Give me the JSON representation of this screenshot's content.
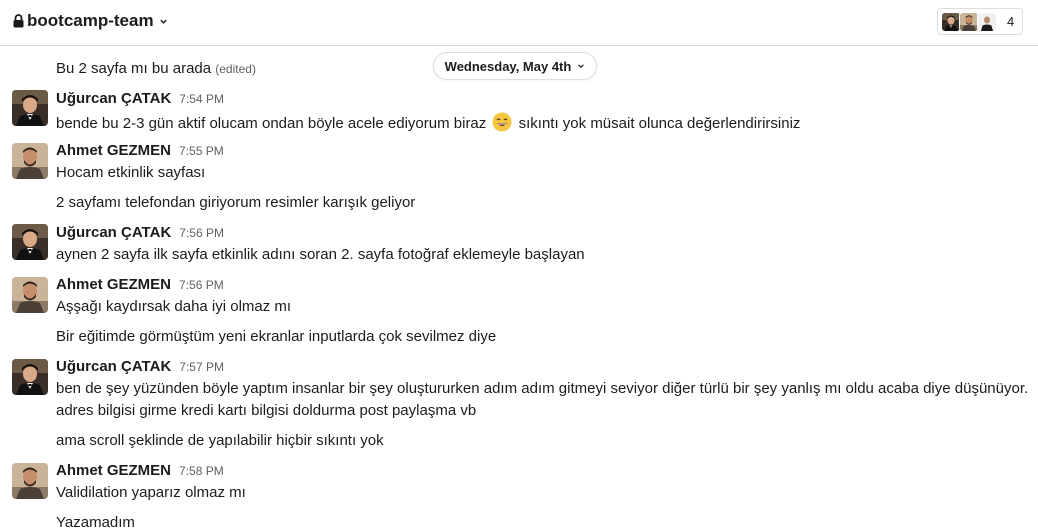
{
  "channel": {
    "name": "bootcamp-team",
    "member_count": "4"
  },
  "date_divider": "Wednesday, May 4th",
  "first_line": {
    "text": "Bu 2 sayfa mı bu arada",
    "edited": "(edited)"
  },
  "users": {
    "ugurcan": {
      "name": "Uğurcan ÇATAK"
    },
    "ahmet": {
      "name": "Ahmet GEZMEN"
    }
  },
  "messages": [
    {
      "sender": "Uğurcan ÇATAK",
      "time": "7:54 PM",
      "text_before": "bende bu 2-3 gün aktif olucam ondan böyle acele ediyorum biraz",
      "emoji": "smile-emoji",
      "text_after": "sıkıntı yok müsait olunca değerlendirirsiniz"
    },
    {
      "sender": "Ahmet GEZMEN",
      "time": "7:55 PM",
      "lines": [
        "Hocam etkinlik sayfası",
        "2 sayfamı telefondan giriyorum resimler karışık geliyor"
      ]
    },
    {
      "sender": "Uğurcan ÇATAK",
      "time": "7:56 PM",
      "lines": [
        "aynen 2 sayfa ilk sayfa etkinlik adını soran 2. sayfa fotoğraf eklemeyle başlayan"
      ]
    },
    {
      "sender": "Ahmet GEZMEN",
      "time": "7:56 PM",
      "lines": [
        "Aşşağı kaydırsak daha iyi olmaz mı",
        "Bir eğitimde görmüştüm yeni ekranlar inputlarda çok sevilmez diye"
      ]
    },
    {
      "sender": "Uğurcan ÇATAK",
      "time": "7:57 PM",
      "lines": [
        "ben de şey yüzünden böyle yaptım insanlar bir şey oluştururken adım adım gitmeyi seviyor diğer türlü bir şey yanlış mı oldu acaba diye düşünüyor.",
        "adres bilgisi girme kredi kartı bilgisi doldurma post paylaşma vb",
        "ama scroll şeklinde de yapılabilir hiçbir sıkıntı yok"
      ]
    },
    {
      "sender": "Ahmet GEZMEN",
      "time": "7:58 PM",
      "lines": [
        "Validilation yaparız olmaz mı",
        "Yazamadım"
      ]
    }
  ],
  "colors": {
    "text": "#1d1c1d",
    "muted": "#616061",
    "border": "#dddddd"
  }
}
